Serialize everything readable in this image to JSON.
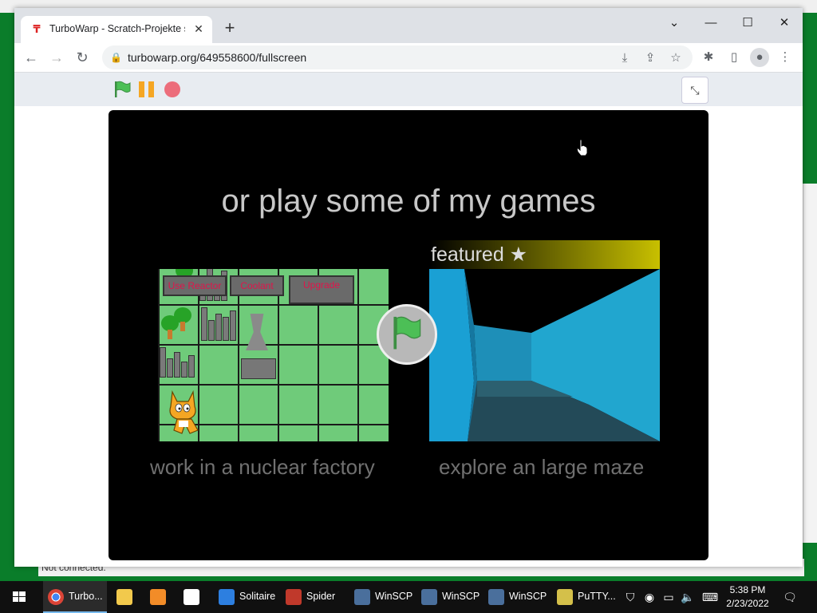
{
  "browser": {
    "tab_title": "TurboWarp - Scratch-Projekte sc",
    "url": "turbowarp.org/649558600/fullscreen"
  },
  "colors": {
    "green_flag": "#4cbf56",
    "pause": "#f5a623",
    "stop": "#ec6d7b",
    "stage_bg": "#000000",
    "desktop": "#0a7d2a"
  },
  "background_window": {
    "status_text": "Not connected."
  },
  "stage": {
    "headline": "or play some of my games",
    "featured_label": "featured ★",
    "game1": {
      "caption": "work in a nuclear factory",
      "buttons": [
        "Use Reactor",
        "Coolant",
        "Upgrade"
      ]
    },
    "game2": {
      "caption": "explore an large maze"
    }
  },
  "taskbar": {
    "items": [
      {
        "label": "Turbo...",
        "icon": "chrome-icon"
      },
      {
        "label": "",
        "icon": "file-explorer-icon"
      },
      {
        "label": "",
        "icon": "media-player-icon"
      },
      {
        "label": "",
        "icon": "document-icon"
      },
      {
        "label": "Solitaire",
        "icon": "solitaire-icon"
      },
      {
        "label": "Spider",
        "icon": "spider-icon"
      },
      {
        "label": "WinSCP",
        "icon": "winscp-icon"
      },
      {
        "label": "WinSCP",
        "icon": "winscp-icon"
      },
      {
        "label": "WinSCP",
        "icon": "winscp-icon"
      },
      {
        "label": "PuTTY...",
        "icon": "putty-icon"
      }
    ],
    "clock": {
      "time": "5:38 PM",
      "date": "2/23/2022"
    }
  }
}
